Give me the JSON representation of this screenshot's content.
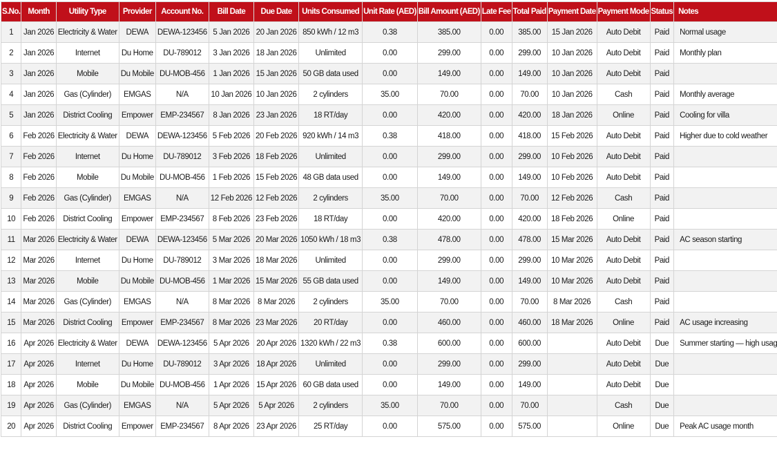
{
  "headers": [
    "S.No.",
    "Month",
    "Utility Type",
    "Provider",
    "Account No.",
    "Bill Date",
    "Due Date",
    "Units Consumed",
    "Unit Rate (AED)",
    "Bill Amount (AED)",
    "Late Fee",
    "Total Paid",
    "Payment Date",
    "Payment Mode",
    "Status",
    "Notes"
  ],
  "rows": [
    [
      "1",
      "Jan 2026",
      "Electricity & Water",
      "DEWA",
      "DEWA-123456",
      "5 Jan 2026",
      "20 Jan 2026",
      "850 kWh / 12 m3",
      "0.38",
      "385.00",
      "0.00",
      "385.00",
      "15 Jan 2026",
      "Auto Debit",
      "Paid",
      "Normal usage"
    ],
    [
      "2",
      "Jan 2026",
      "Internet",
      "Du Home",
      "DU-789012",
      "3 Jan 2026",
      "18 Jan 2026",
      "Unlimited",
      "0.00",
      "299.00",
      "0.00",
      "299.00",
      "10 Jan 2026",
      "Auto Debit",
      "Paid",
      "Monthly plan"
    ],
    [
      "3",
      "Jan 2026",
      "Mobile",
      "Du Mobile",
      "DU-MOB-456",
      "1 Jan 2026",
      "15 Jan 2026",
      "50 GB data used",
      "0.00",
      "149.00",
      "0.00",
      "149.00",
      "10 Jan 2026",
      "Auto Debit",
      "Paid",
      ""
    ],
    [
      "4",
      "Jan 2026",
      "Gas (Cylinder)",
      "EMGAS",
      "N/A",
      "10 Jan 2026",
      "10 Jan 2026",
      "2 cylinders",
      "35.00",
      "70.00",
      "0.00",
      "70.00",
      "10 Jan 2026",
      "Cash",
      "Paid",
      "Monthly average"
    ],
    [
      "5",
      "Jan 2026",
      "District Cooling",
      "Empower",
      "EMP-234567",
      "8 Jan 2026",
      "23 Jan 2026",
      "18 RT/day",
      "0.00",
      "420.00",
      "0.00",
      "420.00",
      "18 Jan 2026",
      "Online",
      "Paid",
      "Cooling for villa"
    ],
    [
      "6",
      "Feb 2026",
      "Electricity & Water",
      "DEWA",
      "DEWA-123456",
      "5 Feb 2026",
      "20 Feb 2026",
      "920 kWh / 14 m3",
      "0.38",
      "418.00",
      "0.00",
      "418.00",
      "15 Feb 2026",
      "Auto Debit",
      "Paid",
      "Higher due to cold weather"
    ],
    [
      "7",
      "Feb 2026",
      "Internet",
      "Du Home",
      "DU-789012",
      "3 Feb 2026",
      "18 Feb 2026",
      "Unlimited",
      "0.00",
      "299.00",
      "0.00",
      "299.00",
      "10 Feb 2026",
      "Auto Debit",
      "Paid",
      ""
    ],
    [
      "8",
      "Feb 2026",
      "Mobile",
      "Du Mobile",
      "DU-MOB-456",
      "1 Feb 2026",
      "15 Feb 2026",
      "48 GB data used",
      "0.00",
      "149.00",
      "0.00",
      "149.00",
      "10 Feb 2026",
      "Auto Debit",
      "Paid",
      ""
    ],
    [
      "9",
      "Feb 2026",
      "Gas (Cylinder)",
      "EMGAS",
      "N/A",
      "12 Feb 2026",
      "12 Feb 2026",
      "2 cylinders",
      "35.00",
      "70.00",
      "0.00",
      "70.00",
      "12 Feb 2026",
      "Cash",
      "Paid",
      ""
    ],
    [
      "10",
      "Feb 2026",
      "District Cooling",
      "Empower",
      "EMP-234567",
      "8 Feb 2026",
      "23 Feb 2026",
      "18 RT/day",
      "0.00",
      "420.00",
      "0.00",
      "420.00",
      "18 Feb 2026",
      "Online",
      "Paid",
      ""
    ],
    [
      "11",
      "Mar 2026",
      "Electricity & Water",
      "DEWA",
      "DEWA-123456",
      "5 Mar 2026",
      "20 Mar 2026",
      "1050 kWh / 18 m3",
      "0.38",
      "478.00",
      "0.00",
      "478.00",
      "15 Mar 2026",
      "Auto Debit",
      "Paid",
      "AC season starting"
    ],
    [
      "12",
      "Mar 2026",
      "Internet",
      "Du Home",
      "DU-789012",
      "3 Mar 2026",
      "18 Mar 2026",
      "Unlimited",
      "0.00",
      "299.00",
      "0.00",
      "299.00",
      "10 Mar 2026",
      "Auto Debit",
      "Paid",
      ""
    ],
    [
      "13",
      "Mar 2026",
      "Mobile",
      "Du Mobile",
      "DU-MOB-456",
      "1 Mar 2026",
      "15 Mar 2026",
      "55 GB data used",
      "0.00",
      "149.00",
      "0.00",
      "149.00",
      "10 Mar 2026",
      "Auto Debit",
      "Paid",
      ""
    ],
    [
      "14",
      "Mar 2026",
      "Gas (Cylinder)",
      "EMGAS",
      "N/A",
      "8 Mar 2026",
      "8 Mar 2026",
      "2 cylinders",
      "35.00",
      "70.00",
      "0.00",
      "70.00",
      "8 Mar 2026",
      "Cash",
      "Paid",
      ""
    ],
    [
      "15",
      "Mar 2026",
      "District Cooling",
      "Empower",
      "EMP-234567",
      "8 Mar 2026",
      "23 Mar 2026",
      "20 RT/day",
      "0.00",
      "460.00",
      "0.00",
      "460.00",
      "18 Mar 2026",
      "Online",
      "Paid",
      "AC usage increasing"
    ],
    [
      "16",
      "Apr 2026",
      "Electricity & Water",
      "DEWA",
      "DEWA-123456",
      "5 Apr 2026",
      "20 Apr 2026",
      "1320 kWh / 22 m3",
      "0.38",
      "600.00",
      "0.00",
      "600.00",
      "",
      "Auto Debit",
      "Due",
      "Summer starting — high usage"
    ],
    [
      "17",
      "Apr 2026",
      "Internet",
      "Du Home",
      "DU-789012",
      "3 Apr 2026",
      "18 Apr 2026",
      "Unlimited",
      "0.00",
      "299.00",
      "0.00",
      "299.00",
      "",
      "Auto Debit",
      "Due",
      ""
    ],
    [
      "18",
      "Apr 2026",
      "Mobile",
      "Du Mobile",
      "DU-MOB-456",
      "1 Apr 2026",
      "15 Apr 2026",
      "60 GB data used",
      "0.00",
      "149.00",
      "0.00",
      "149.00",
      "",
      "Auto Debit",
      "Due",
      ""
    ],
    [
      "19",
      "Apr 2026",
      "Gas (Cylinder)",
      "EMGAS",
      "N/A",
      "5 Apr 2026",
      "5 Apr 2026",
      "2 cylinders",
      "35.00",
      "70.00",
      "0.00",
      "70.00",
      "",
      "Cash",
      "Due",
      ""
    ],
    [
      "20",
      "Apr 2026",
      "District Cooling",
      "Empower",
      "EMP-234567",
      "8 Apr 2026",
      "23 Apr 2026",
      "25 RT/day",
      "0.00",
      "575.00",
      "0.00",
      "575.00",
      "",
      "Online",
      "Due",
      "Peak AC usage month"
    ]
  ],
  "colors": {
    "header_bg": "#c0101a",
    "header_text": "#ffffff",
    "row_alt": "#f2f2f2",
    "grid": "#d4d4d4"
  }
}
